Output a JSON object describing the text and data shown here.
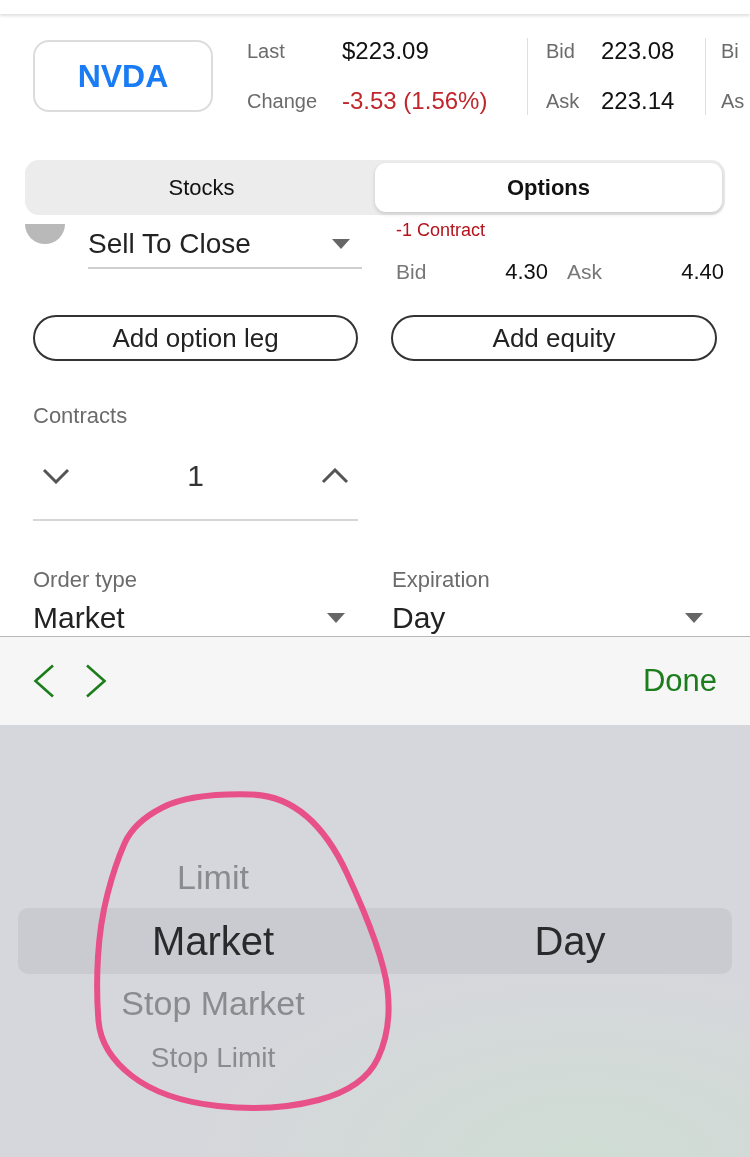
{
  "quote": {
    "symbol": "NVDA",
    "fields": [
      {
        "label": "Last",
        "value": "$223.09",
        "kind": "plain"
      },
      {
        "label": "Change",
        "value": "-3.53 (1.56%)",
        "kind": "down"
      }
    ],
    "bid_ask": [
      {
        "label": "Bid",
        "value": "223.08"
      },
      {
        "label": "Ask",
        "value": "223.14"
      }
    ],
    "column_3": [
      "Bi",
      "As"
    ]
  },
  "tabs": [
    {
      "label": "Stocks",
      "selected": false
    },
    {
      "label": "Options",
      "selected": true
    }
  ],
  "leg": {
    "action": "Sell To Close",
    "quantity": "-1 Contract",
    "prices": [
      {
        "label": "Bid",
        "value": "4.30"
      },
      {
        "label": "Ask",
        "value": "4.40"
      }
    ]
  },
  "buttons": [
    "Add option leg",
    "Add equity"
  ],
  "contracts": {
    "label": "Contracts",
    "value": "1"
  },
  "order_fields": [
    {
      "label": "Order type",
      "value": "Market"
    },
    {
      "label": "Expiration",
      "value": "Day"
    }
  ],
  "toolbar": {
    "done": "Done"
  },
  "picker": {
    "columns": [
      {
        "items": [
          {
            "label": "Limit",
            "selected": false
          },
          {
            "label": "Market",
            "selected": true
          },
          {
            "label": "Stop Market",
            "selected": false
          },
          {
            "label": "Stop Limit",
            "selected": false
          }
        ]
      },
      {
        "items": [
          {
            "label": "Day",
            "selected": true
          }
        ]
      }
    ]
  }
}
